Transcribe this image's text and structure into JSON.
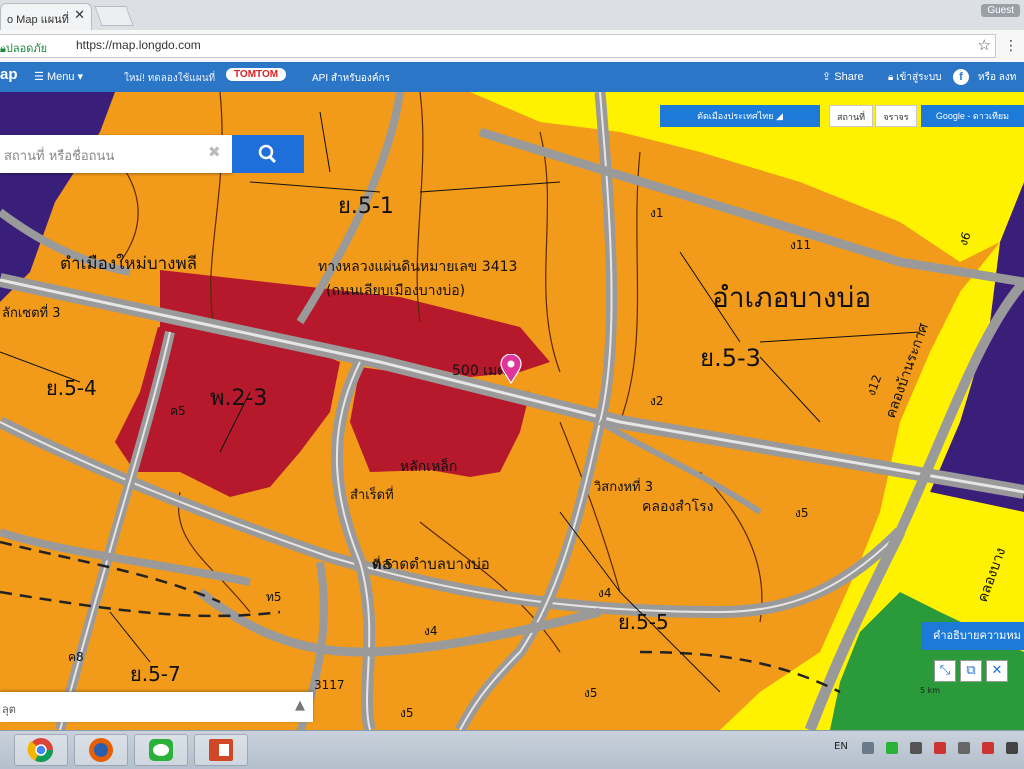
{
  "browser": {
    "tab_title": "o Map แผนที่",
    "tab_close": "✕",
    "user_badge": "Guest",
    "secure_label": "ปลอดภัย",
    "url": "https://map.longdo.com"
  },
  "site_nav": {
    "logo": "ap",
    "menu_label": "Menu ▾",
    "promo": "ใหม่! ทดลองใช้แผนที่",
    "tomtom": "TOMTOM",
    "api_label": "API สำหรับองค์กร",
    "share_label": "Share",
    "login_label": "เข้าสู่ระบบ",
    "or_label": "หรือ ลงท"
  },
  "search": {
    "placeholder": "สถานที่ หรือชื่อถนน",
    "clear": "✖"
  },
  "map_controls": {
    "layer_select": "ตัดเมืองประเทศไทย",
    "place_btn": "สถานที่",
    "traffic_btn": "จราจร",
    "basemap_btn": "Google - ดาวเทียม",
    "legend_btn": "คำอธิบายความหม",
    "scale_label": "5 km"
  },
  "bottom_panel": {
    "text": "ลุต",
    "arrow": "▲"
  },
  "map_labels": {
    "y51": "ย.5-1",
    "y53": "ย.5-3",
    "y54": "ย.5-4",
    "y55": "ย.5-5",
    "y57": "ย.5-7",
    "p23": "พ.2-3",
    "district": "อำเภอบางบ่อ",
    "municipality_upper": "ตำเมืองใหม่บางพลี",
    "highway_label": "ทางหลวงแผ่นดินหมายเลข 3413",
    "highway_sub": "(ถนนเลียบเมืองบางบ่อ)",
    "distance": "500 เมตร",
    "subdistrict": "ตลาดตำบลบางบ่อ",
    "canal1": "คลองสำโรง",
    "canal2": "คลองบ้านระกาศ",
    "canal3": "คลองบาง",
    "soi3": "ลักเซตที่ 3",
    "ng11": "ง11",
    "ng12": "ง12",
    "ng16": "ง6",
    "n1": "ง1",
    "n2": "ง2",
    "n4": "ง4",
    "n5": "ง5",
    "n6": "ง5",
    "r5": "ค5",
    "k5": "ง5",
    "n8": "ค8",
    "n3117": "3117",
    "t5": "ท5",
    "t4": "ง4",
    "tee3": "วิสกงหที่ 3",
    "tee5": "ที่ 5",
    "road_title": "หลักเหล็ก",
    "sakk": "สำเร็ดที่"
  },
  "taskbar": {
    "lang": "EN"
  },
  "colors": {
    "orange_zone": "#f29a1a",
    "red_zone": "#b5192b",
    "yellow_zone": "#fff200",
    "purple_zone": "#3a1f7a",
    "green_zone": "#2a9a3a",
    "accent_blue": "#1e6fd9",
    "road_grey": "#b8b8b8"
  }
}
